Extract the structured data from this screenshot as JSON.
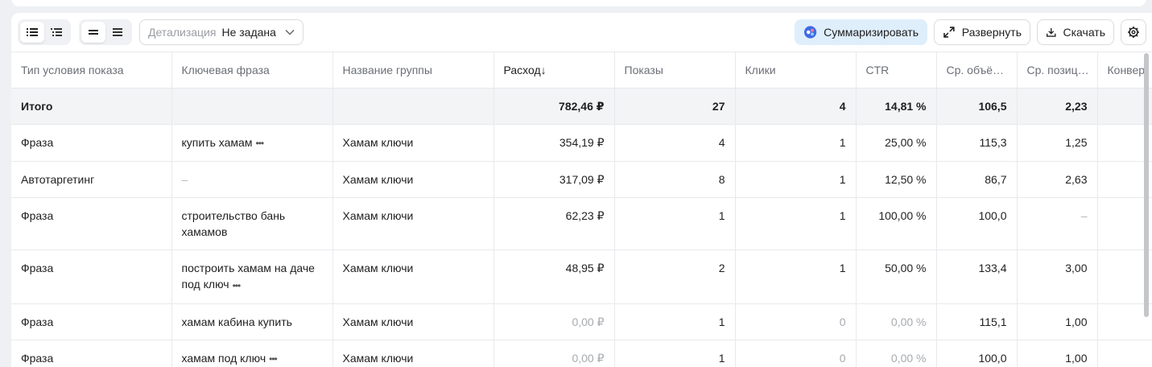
{
  "toolbar": {
    "detalization_label": "Детализация",
    "detalization_value": "Не задана",
    "summarize_label": "Суммаризировать",
    "expand_label": "Развернуть",
    "download_label": "Скачать"
  },
  "table": {
    "headers": [
      "Тип условия показа",
      "Ключевая фраза",
      "Название группы",
      "Расход",
      "Показы",
      "Клики",
      "CTR",
      "Ср. объё…",
      "Ср. позиц…",
      "Конвер"
    ],
    "sort_arrow": "↓",
    "total": {
      "label": "Итого",
      "spend": "782,46 ₽",
      "impressions": "27",
      "clicks": "4",
      "ctr": "14,81 %",
      "avg_volume": "106,5",
      "avg_position": "2,23"
    },
    "rows": [
      {
        "type": "Фраза",
        "phrase": "купить хамам",
        "group": "Хамам ключи",
        "spend": "354,19 ₽",
        "impressions": "4",
        "clicks": "1",
        "ctr": "25,00 %",
        "avg_volume": "115,3",
        "avg_position": "1,25"
      },
      {
        "type": "Автотаргетинг",
        "phrase": "–",
        "group": "Хамам ключи",
        "spend": "317,09 ₽",
        "impressions": "8",
        "clicks": "1",
        "ctr": "12,50 %",
        "avg_volume": "86,7",
        "avg_position": "2,63"
      },
      {
        "type": "Фраза",
        "phrase": "строительство бань хамамов",
        "group": "Хамам ключи",
        "spend": "62,23 ₽",
        "impressions": "1",
        "clicks": "1",
        "ctr": "100,00 %",
        "avg_volume": "100,0",
        "avg_position": "–"
      },
      {
        "type": "Фраза",
        "phrase": "построить хамам на даче под ключ",
        "group": "Хамам ключи",
        "spend": "48,95 ₽",
        "impressions": "2",
        "clicks": "1",
        "ctr": "50,00 %",
        "avg_volume": "133,4",
        "avg_position": "3,00"
      },
      {
        "type": "Фраза",
        "phrase": "хамам кабина купить",
        "group": "Хамам ключи",
        "spend": "0,00 ₽",
        "impressions": "1",
        "clicks": "0",
        "ctr": "0,00 %",
        "avg_volume": "115,1",
        "avg_position": "1,00"
      },
      {
        "type": "Фраза",
        "phrase": "хамам под ключ",
        "group": "Хамам ключи",
        "spend": "0,00 ₽",
        "impressions": "1",
        "clicks": "0",
        "ctr": "0,00 %",
        "avg_volume": "100,0",
        "avg_position": "1,00"
      }
    ],
    "more_icon": "ellipsis-icon"
  },
  "colors": {
    "ai_button_bg": "#dfeefb",
    "muted_text": "#a7aaaf",
    "total_row_bg": "#f3f4f6"
  }
}
